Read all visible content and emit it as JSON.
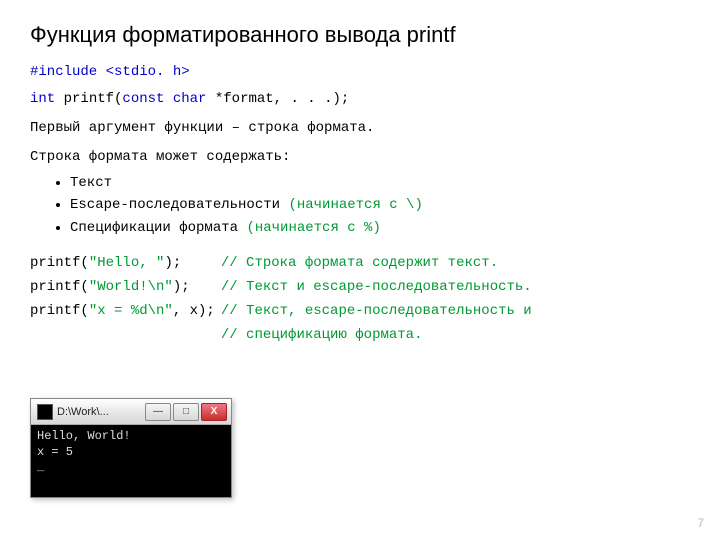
{
  "title": "Функция форматированного вывода printf",
  "code": {
    "include_kw": "#include",
    "include_arg": "<stdio. h>",
    "decl": {
      "type": "int ",
      "fn": "printf(",
      "const": "const ",
      "char": "char ",
      "rest": "*format, . . .);"
    }
  },
  "para1": "Первый аргумент функции – строка формата.",
  "para2": "Строка формата может содержать:",
  "bullets": {
    "b1": "Текст",
    "b2_a": "Escape-последовательности ",
    "b2_b": "(начинается с \\)",
    "b3_a": "Спецификации формата ",
    "b3_b": "(начинается с %)"
  },
  "examples": {
    "r1_code_a": "printf(",
    "r1_code_b": "\"Hello, \"",
    "r1_code_c": ");",
    "r1_cmt": "// Строка формата содержит текст.",
    "r2_code_a": "printf(",
    "r2_code_b": "\"World!\\n\"",
    "r2_code_c": ");",
    "r2_cmt": "// Текст и escape-последовательность.",
    "r3_code_a": "printf(",
    "r3_code_b": "\"x = %d\\n\"",
    "r3_code_c": ", x);",
    "r3_cmt": "// Текст, escape-последовательность и",
    "r4_cmt": "// спецификацию формата."
  },
  "console": {
    "title": "D:\\Work\\...",
    "line1": "Hello, World!",
    "line2": "x = 5",
    "cursor": "_",
    "min": "—",
    "max": "□",
    "close": "X"
  },
  "page_number": "7"
}
